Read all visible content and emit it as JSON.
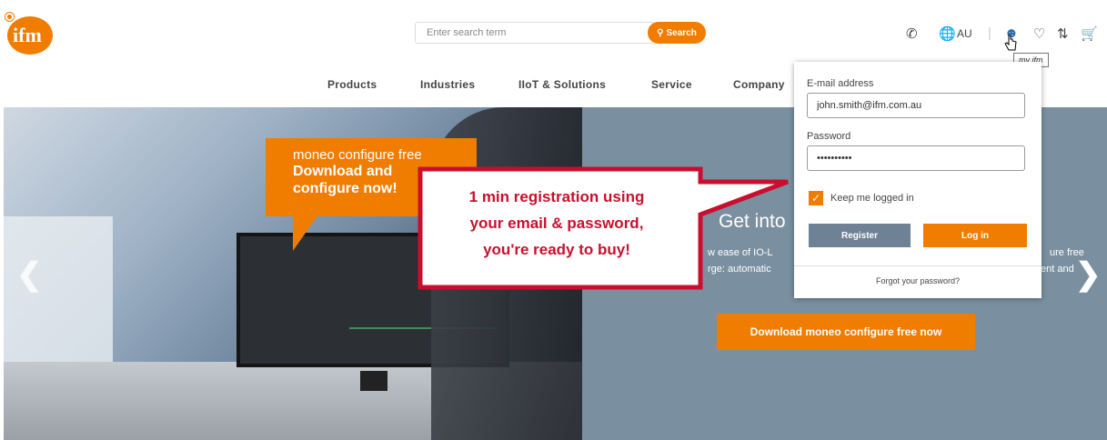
{
  "header": {
    "search_placeholder": "Enter search term",
    "search_button": "Search",
    "region": "AU",
    "tooltip": "my ifm"
  },
  "nav": {
    "items": [
      "Products",
      "Industries",
      "IIoT & Solutions",
      "Service",
      "Company"
    ]
  },
  "hero": {
    "promo_line1": "moneo configure free",
    "promo_line2": "Download and",
    "promo_line3": "configure now!",
    "title": "Get into",
    "text1": "w ease of IO-L",
    "text2": "rge: automatic",
    "text3": "ure free",
    "text4": "ent and",
    "download_button": "Download moneo configure free now"
  },
  "callout": {
    "line1": "1 min registration using",
    "line2": "your email & password,",
    "line3": "you're ready to buy!"
  },
  "login": {
    "email_label": "E-mail address",
    "email_value": "john.smith@ifm.com.au",
    "password_label": "Password",
    "password_value": "••••••••••",
    "keep_logged_in": "Keep me logged in",
    "register_button": "Register",
    "login_button": "Log in",
    "forgot_password": "Forgot your password?"
  },
  "colors": {
    "brand_orange": "#f07d00",
    "callout_red": "#c8102e",
    "hero_blue": "#7a90a0"
  }
}
